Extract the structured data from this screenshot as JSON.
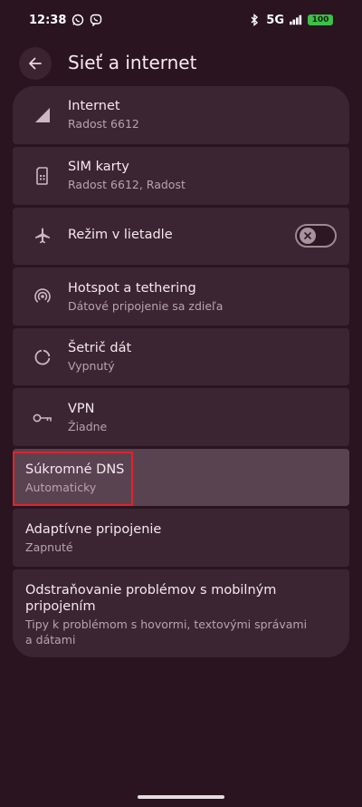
{
  "status_bar": {
    "time": "12:38",
    "network": "5G",
    "battery": "100"
  },
  "header": {
    "title": "Sieť a internet"
  },
  "items": [
    {
      "primary": "Internet",
      "secondary": "Radost 6612",
      "icon": "signal-icon"
    },
    {
      "primary": "SIM karty",
      "secondary": "Radost 6612, Radost",
      "icon": "sim-card-icon"
    },
    {
      "primary": "Režim v lietadle",
      "icon": "airplane-icon",
      "toggle": "off"
    },
    {
      "primary": "Hotspot a tethering",
      "secondary": "Dátové pripojenie sa zdieľa",
      "icon": "hotspot-icon"
    },
    {
      "primary": "Šetrič dát",
      "secondary": "Vypnutý",
      "icon": "data-saver-icon"
    },
    {
      "primary": "VPN",
      "secondary": "Žiadne",
      "icon": "vpn-key-icon"
    },
    {
      "primary": "Súkromné DNS",
      "secondary": "Automaticky"
    },
    {
      "primary": "Adaptívne pripojenie",
      "secondary": "Zapnuté"
    },
    {
      "primary_line1": "Odstraňovanie problémov s mobilným",
      "primary_line2": "pripojením",
      "secondary_line1": "Tipy k problémom s hovormi, textovými správami",
      "secondary_line2": "a dátami"
    }
  ],
  "colors": {
    "background": "#2a1420",
    "card": "#3b2532",
    "card_highlighted": "#5a4350",
    "highlight_border": "#e0232c"
  }
}
